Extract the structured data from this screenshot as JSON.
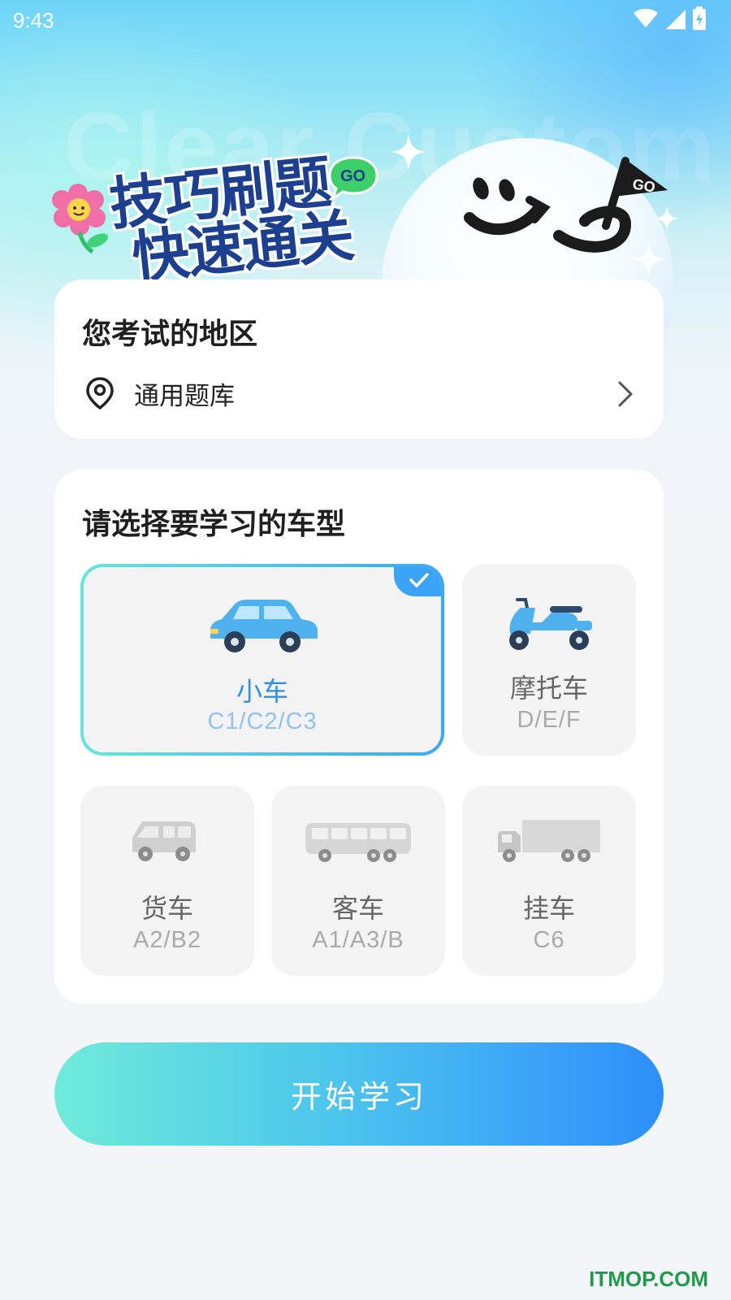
{
  "status_bar": {
    "time": "9:43"
  },
  "banner": {
    "ghost_text": "Clear Custom",
    "line1": "技巧刷题",
    "line2": "快速通关",
    "bubble_text": "GO",
    "flag_text": "GO"
  },
  "region": {
    "title": "您考试的地区",
    "value": "通用题库"
  },
  "vehicle_section": {
    "title": "请选择要学习的车型",
    "types": [
      {
        "name": "小车",
        "code": "C1/C2/C3",
        "selected": true
      },
      {
        "name": "摩托车",
        "code": "D/E/F",
        "selected": false
      },
      {
        "name": "货车",
        "code": "A2/B2",
        "selected": false
      },
      {
        "name": "客车",
        "code": "A1/A3/B",
        "selected": false
      },
      {
        "name": "挂车",
        "code": "C6",
        "selected": false
      }
    ]
  },
  "start_button": {
    "label": "开始学习"
  },
  "watermark": "ITMOP.COM",
  "colors": {
    "accent": "#3aa2f7",
    "selected_text": "#2f8fe8",
    "button_start": "#6fecd9",
    "button_end": "#2d8ef9"
  }
}
